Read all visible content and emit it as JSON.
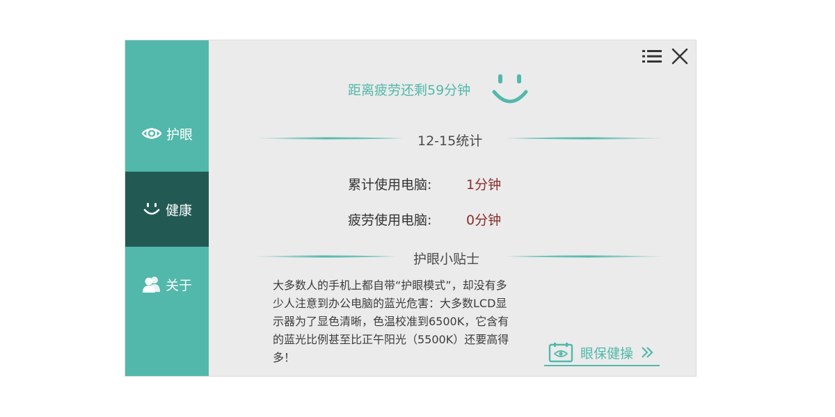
{
  "sidebar": {
    "items": [
      {
        "label": "护眼",
        "icon": "eye-icon"
      },
      {
        "label": "健康",
        "icon": "smile-icon",
        "active": true
      },
      {
        "label": "关于",
        "icon": "users-icon"
      }
    ]
  },
  "header": {
    "menu_icon": "menu-icon",
    "close_icon": "close-icon",
    "status_text": "距离疲劳还剩59分钟"
  },
  "stats": {
    "title": "12-15统计",
    "rows": [
      {
        "label": "累计使用电脑:",
        "value": "1分钟"
      },
      {
        "label": "疲劳使用电脑:",
        "value": "0分钟"
      }
    ]
  },
  "tips": {
    "title": "护眼小贴士",
    "body": "大多数人的手机上都自带“护眼模式”，却没有多少人注意到办公电脑的蓝光危害：大多数LCD显示器为了显色清晰，色温校准到6500K，它含有的蓝光比例甚至比正午阳光（5500K）还要高得多！"
  },
  "exercise": {
    "label": "眼保健操",
    "icon": "calendar-eye-icon"
  },
  "colors": {
    "accent": "#52b8ab",
    "sidebar_active": "#225a53",
    "value": "#8b2b2b",
    "panel": "#ebebeb"
  }
}
